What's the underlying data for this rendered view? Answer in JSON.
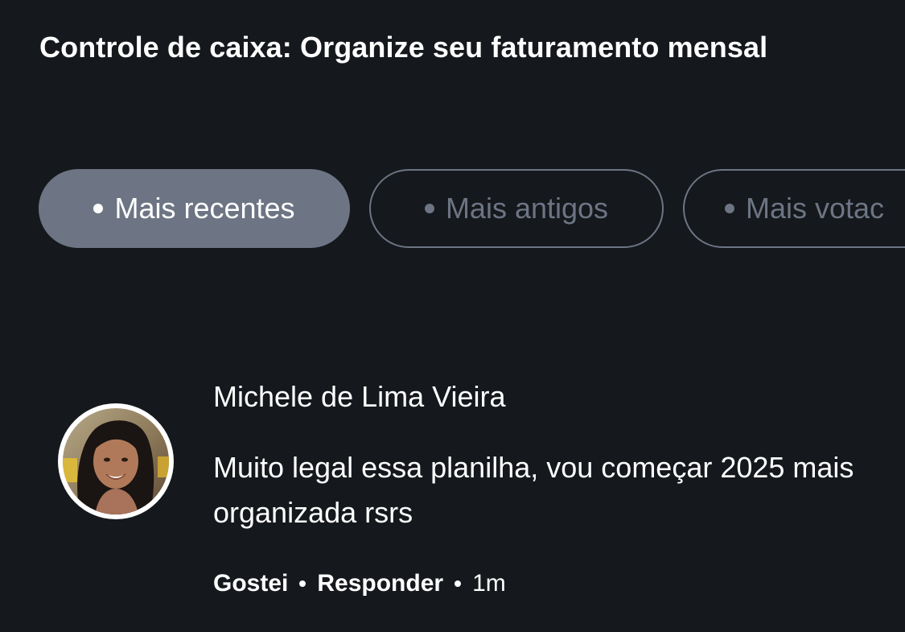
{
  "post": {
    "title": "Controle de caixa: Organize seu faturamento mensal"
  },
  "sort_filters": [
    {
      "label": "Mais recentes",
      "selected": true
    },
    {
      "label": "Mais antigos",
      "selected": false
    },
    {
      "label": "Mais votac",
      "selected": false
    }
  ],
  "comment": {
    "author": "Michele de Lima Vieira",
    "text": "Muito legal essa planilha, vou começar 2025 mais organizada rsrs",
    "actions": {
      "like_label": "Gostei",
      "reply_label": "Responder",
      "time": "1m"
    }
  },
  "colors": {
    "background": "#15181c",
    "chip_active_bg": "#6d7584",
    "chip_outline": "#6d7584",
    "text": "#ffffff"
  },
  "icons": {
    "bullet": "bullet-dot"
  }
}
